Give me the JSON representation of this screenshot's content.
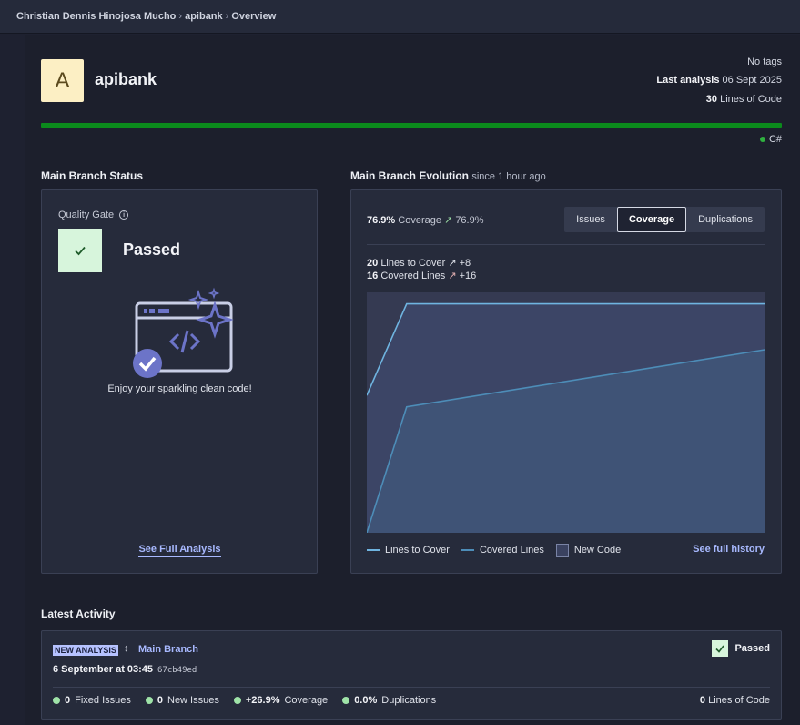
{
  "breadcrumb": [
    "Christian Dennis Hinojosa Mucho",
    "apibank",
    "Overview"
  ],
  "project": {
    "avatar_letter": "A",
    "name": "apibank",
    "tags": "No tags",
    "last_analysis_label": "Last analysis",
    "last_analysis_date": "06 Sept 2025",
    "loc_value": "30",
    "loc_label": "Lines of Code",
    "language": "C#",
    "language_share": 1.0,
    "language_color": "#2fb03f"
  },
  "status": {
    "title": "Main Branch Status",
    "quality_gate_label": "Quality Gate",
    "result": "Passed",
    "message": "Enjoy your sparkling clean code!",
    "see_full_analysis": "See Full Analysis"
  },
  "evolution": {
    "title": "Main Branch Evolution",
    "since": "since 1 hour ago",
    "coverage_value": "76.9%",
    "coverage_label": "Coverage",
    "coverage_trend": "76.9%",
    "tabs": [
      "Issues",
      "Coverage",
      "Duplications"
    ],
    "active_tab": "Coverage",
    "lines_to_cover_value": "20",
    "lines_to_cover_label": "Lines to Cover",
    "lines_to_cover_delta": "+8",
    "covered_value": "16",
    "covered_label": "Covered Lines",
    "covered_delta": "+16",
    "legend": [
      "Lines to Cover",
      "Covered Lines",
      "New Code"
    ],
    "see_history": "See full history"
  },
  "chart_data": {
    "type": "area",
    "title": "",
    "xlabel": "",
    "ylabel": "",
    "ylim": [
      0,
      21
    ],
    "series": [
      {
        "name": "Lines to Cover",
        "points": [
          [
            0,
            12
          ],
          [
            0.1,
            20
          ],
          [
            1,
            20
          ]
        ],
        "color": "#6fb4e0"
      },
      {
        "name": "Covered Lines",
        "points": [
          [
            0,
            0
          ],
          [
            0.1,
            11
          ],
          [
            1,
            16
          ]
        ],
        "color": "#4d8db8"
      }
    ],
    "grid": false,
    "legend_position": "bottom-left"
  },
  "activity": {
    "title": "Latest Activity",
    "badge": "NEW ANALYSIS",
    "branch": "Main Branch",
    "result": "Passed",
    "date": "6 September at 03:45",
    "hash": "67cb49ed",
    "metrics": [
      {
        "value": "0",
        "label": "Fixed Issues"
      },
      {
        "value": "0",
        "label": "New Issues"
      },
      {
        "value": "+26.9%",
        "label": "Coverage"
      },
      {
        "value": "0.0%",
        "label": "Duplications"
      }
    ],
    "loc_value": "0",
    "loc_label": "Lines of Code"
  }
}
